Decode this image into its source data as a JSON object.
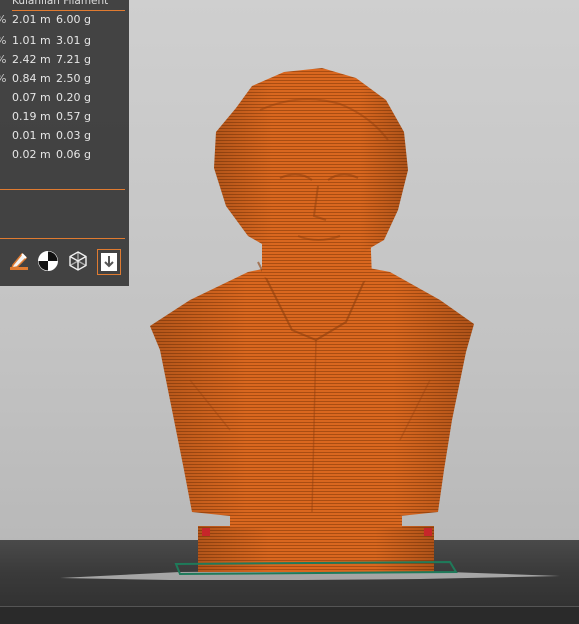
{
  "panel": {
    "header": "Kulanilan Filament",
    "rows": [
      {
        "pct": "%",
        "length": "2.01 m",
        "weight": "6.00 g"
      },
      {
        "pct": "%",
        "length": "1.01 m",
        "weight": "3.01 g"
      },
      {
        "pct": "%",
        "length": "2.42 m",
        "weight": "7.21 g"
      },
      {
        "pct": "%",
        "length": "0.84 m",
        "weight": "2.50 g"
      },
      {
        "pct": "",
        "length": "0.07 m",
        "weight": "0.20 g"
      },
      {
        "pct": "",
        "length": "0.19 m",
        "weight": "0.57 g"
      },
      {
        "pct": "",
        "length": "0.01 m",
        "weight": "0.03 g"
      },
      {
        "pct": "",
        "length": "0.02 m",
        "weight": "0.06 g"
      }
    ],
    "tools": [
      {
        "name": "edit-paint-icon"
      },
      {
        "name": "seam-icon"
      },
      {
        "name": "wireframe-cube-icon"
      },
      {
        "name": "export-download-icon"
      }
    ]
  },
  "colors": {
    "model": "#d9671f",
    "accent": "#e07b31",
    "panel": "#383838",
    "bed_outline": "#1f7a5a"
  }
}
